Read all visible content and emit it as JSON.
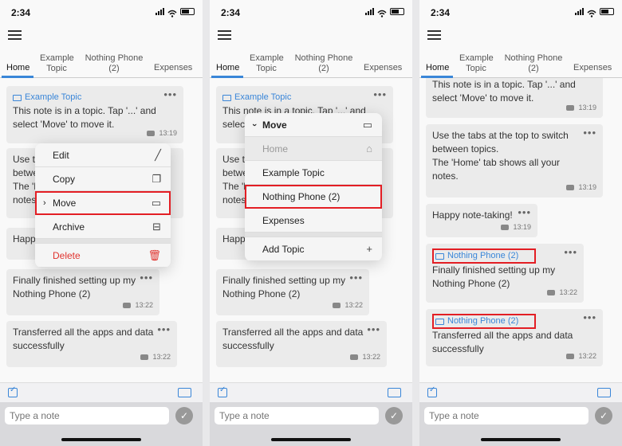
{
  "status": {
    "time": "2:34"
  },
  "tabs": [
    {
      "label": "Home"
    },
    {
      "label": "Example Topic"
    },
    {
      "label": "Nothing Phone (2)"
    },
    {
      "label": "Expenses"
    }
  ],
  "notes": {
    "topic_note": {
      "topic": "Example Topic",
      "text": "This note is in a topic. Tap '...' and select 'Move' to move it.",
      "time": "13:19"
    },
    "tabs_note": {
      "text": "Use the tabs at the top to switch between topics.\nThe 'Home' tab shows all your notes.",
      "time": "13:19"
    },
    "happy_note": {
      "text": "Happy note-taking!",
      "time": "13:19"
    },
    "phone_note": {
      "topic": "Nothing Phone (2)",
      "text": "Finally finished setting up my Nothing Phone (2)",
      "time": "13:22"
    },
    "transfer_note": {
      "topic": "Nothing Phone (2)",
      "text": "Transferred all the apps and data successfully",
      "time": "13:22"
    }
  },
  "context_menu": {
    "items": [
      "Edit",
      "Copy",
      "Move",
      "Archive",
      "Delete"
    ]
  },
  "move_menu": {
    "title": "Move",
    "items": [
      "Home",
      "Example Topic",
      "Nothing Phone (2)",
      "Expenses",
      "Add Topic"
    ]
  },
  "composer": {
    "placeholder": "Type a note"
  },
  "colors": {
    "accent": "#3a86d8",
    "highlight": "#e31e24",
    "delete": "#e0342f"
  }
}
